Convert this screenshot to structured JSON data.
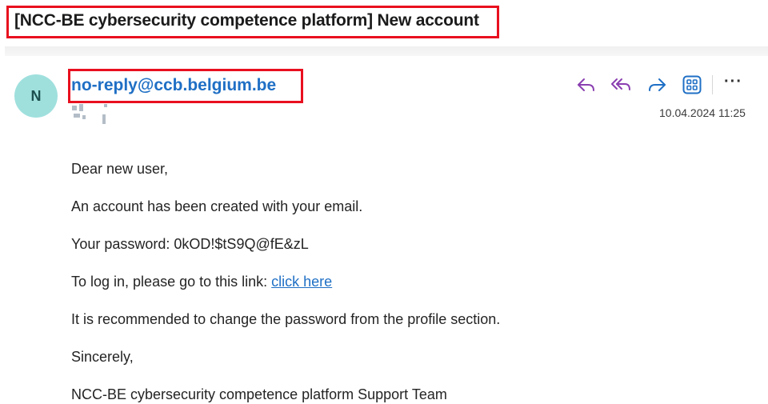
{
  "email": {
    "subject": "[NCC-BE cybersecurity competence platform] New account",
    "sender": {
      "initial": "N",
      "address": "no-reply@ccb.belgium.be"
    },
    "timestamp": "10.04.2024 11:25",
    "actions": {
      "reply_icon": "reply-icon",
      "reply_all_icon": "reply-all-icon",
      "forward_icon": "forward-icon",
      "apps_icon": "apps-icon",
      "more_label": "···"
    },
    "body": {
      "greeting": "Dear new user,",
      "line1": "An account has been created with your email.",
      "password_line": "Your password: 0kOD!$tS9Q@fE&zL",
      "login_prefix": "To log in, please go to this link: ",
      "login_link": "click here",
      "line4": "It is recommended to change the password from the profile section.",
      "closing": "Sincerely,",
      "signature": "NCC-BE cybersecurity competence platform Support Team"
    }
  },
  "colors": {
    "highlight_border": "#e8101f",
    "link": "#1f6fc5",
    "avatar_bg": "#9fe0dd",
    "action_purple": "#8a3fb0",
    "action_blue": "#1f6fc5"
  }
}
